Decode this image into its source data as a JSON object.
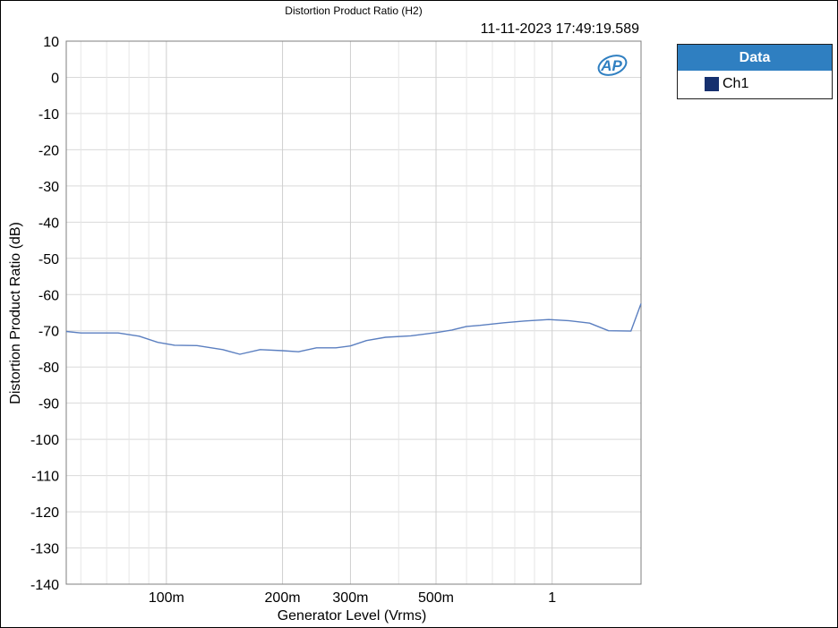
{
  "chart_data": {
    "type": "line",
    "title": "Distortion Product Ratio (H2)",
    "timestamp": "11-11-2023 17:49:19.589",
    "xlabel": "Generator Level (Vrms)",
    "ylabel": "Distortion Product Ratio (dB)",
    "x_scale": "log",
    "xlim": [
      0.055,
      1.7
    ],
    "ylim": [
      -140,
      10
    ],
    "grid": true,
    "y_ticks": [
      10,
      0,
      -10,
      -20,
      -30,
      -40,
      -50,
      -60,
      -70,
      -80,
      -90,
      -100,
      -110,
      -120,
      -130,
      -140
    ],
    "y_tick_labels": [
      "10",
      "0",
      "-10",
      "-20",
      "-30",
      "-40",
      "-50",
      "-60",
      "-70",
      "-80",
      "-90",
      "-100",
      "-110",
      "-120",
      "-130",
      "-140"
    ],
    "x_major_ticks": [
      0.1,
      0.2,
      0.3,
      0.5,
      1
    ],
    "x_tick_labels": [
      "100m",
      "200m",
      "300m",
      "500m",
      "1"
    ],
    "x_grid_lines": [
      0.06,
      0.07,
      0.08,
      0.09,
      0.1,
      0.2,
      0.3,
      0.4,
      0.5,
      0.6,
      0.7,
      0.8,
      0.9,
      1
    ],
    "legend": {
      "title": "Data",
      "placement": "outside-right-top"
    },
    "series": [
      {
        "name": "Ch1",
        "color": "#5b7fc0",
        "swatch_color": "#16306e",
        "x": [
          0.055,
          0.06,
          0.07,
          0.075,
          0.085,
          0.095,
          0.105,
          0.12,
          0.14,
          0.155,
          0.175,
          0.2,
          0.22,
          0.245,
          0.275,
          0.3,
          0.33,
          0.37,
          0.43,
          0.5,
          0.55,
          0.6,
          0.65,
          0.75,
          0.85,
          0.98,
          1.1,
          1.25,
          1.4,
          1.6,
          1.7
        ],
        "y": [
          -70.2,
          -70.6,
          -70.6,
          -70.6,
          -71.5,
          -73.2,
          -74.0,
          -74.1,
          -75.2,
          -76.5,
          -75.2,
          -75.5,
          -75.8,
          -74.7,
          -74.7,
          -74.2,
          -72.7,
          -71.8,
          -71.4,
          -70.5,
          -69.8,
          -68.8,
          -68.5,
          -67.8,
          -67.3,
          -66.9,
          -67.2,
          -67.9,
          -70.0,
          -70.1,
          -62.5
        ]
      }
    ]
  },
  "branding": {
    "logo_text": "AP",
    "logo_color": "#2f7fc1"
  }
}
